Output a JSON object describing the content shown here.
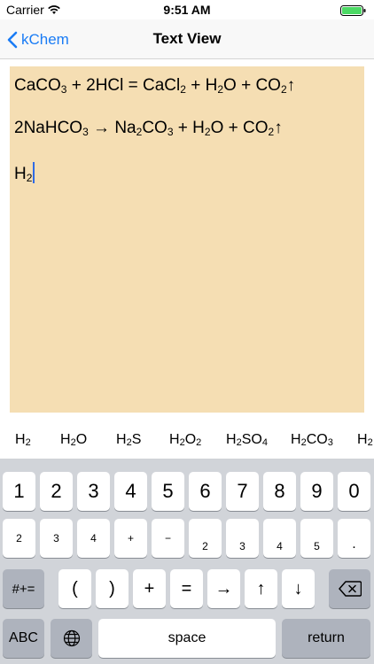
{
  "status_bar": {
    "carrier": "Carrier",
    "time": "9:51 AM"
  },
  "nav": {
    "back_label": "kChem",
    "title": "Text View"
  },
  "text_view": {
    "background": "#f5deb3",
    "lines": [
      [
        {
          "t": "CaCO"
        },
        {
          "s": "3"
        },
        {
          "t": " + 2HCl = CaCl"
        },
        {
          "s": "2"
        },
        {
          "t": " + H"
        },
        {
          "s": "2"
        },
        {
          "t": "O + CO"
        },
        {
          "s": "2"
        },
        {
          "t": "↑"
        }
      ],
      [
        {
          "t": "2NaHCO"
        },
        {
          "s": "3"
        },
        {
          "t": " → Na"
        },
        {
          "s": "2"
        },
        {
          "t": "CO"
        },
        {
          "s": "3"
        },
        {
          "t": " + H"
        },
        {
          "s": "2"
        },
        {
          "t": "O + CO"
        },
        {
          "s": "2"
        },
        {
          "t": "↑"
        }
      ],
      [
        {
          "t": "H"
        },
        {
          "s": "2"
        }
      ]
    ]
  },
  "suggestions": [
    [
      {
        "t": "H"
      },
      {
        "s": "2"
      }
    ],
    [
      {
        "t": "H"
      },
      {
        "s": "2"
      },
      {
        "t": "O"
      }
    ],
    [
      {
        "t": "H"
      },
      {
        "s": "2"
      },
      {
        "t": "S"
      }
    ],
    [
      {
        "t": "H"
      },
      {
        "s": "2"
      },
      {
        "t": "O"
      },
      {
        "s": "2"
      }
    ],
    [
      {
        "t": "H"
      },
      {
        "s": "2"
      },
      {
        "t": "SO"
      },
      {
        "s": "4"
      }
    ],
    [
      {
        "t": "H"
      },
      {
        "s": "2"
      },
      {
        "t": "CO"
      },
      {
        "s": "3"
      }
    ],
    [
      {
        "t": "H"
      },
      {
        "s": "2"
      }
    ]
  ],
  "keyboard": {
    "row1": [
      "1",
      "2",
      "3",
      "4",
      "5",
      "6",
      "7",
      "8",
      "9",
      "0"
    ],
    "row2": [
      "2",
      "3",
      "4",
      "+",
      "−",
      "2",
      "3",
      "4",
      "5",
      "."
    ],
    "row3": {
      "mode": "#+=",
      "keys": [
        "(",
        ")",
        "+",
        "=",
        "→",
        "↑",
        "↓"
      ],
      "delete": "⌫"
    },
    "row4": {
      "abc": "ABC",
      "space": "space",
      "return": "return"
    }
  },
  "colors": {
    "accent": "#1a7cf5",
    "cursor": "#2f6be6",
    "keyboard_bg": "#d1d4d9"
  }
}
